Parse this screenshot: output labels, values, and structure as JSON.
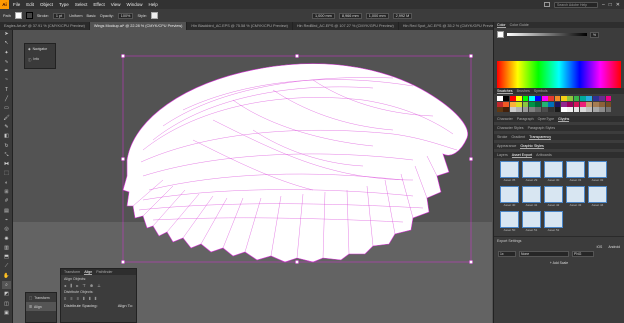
{
  "menubar": {
    "logo": "Ai",
    "items": [
      "File",
      "Edit",
      "Object",
      "Type",
      "Select",
      "Effect",
      "View",
      "Window",
      "Help"
    ],
    "search_placeholder": "Search Adobe Help"
  },
  "control": {
    "selection": "Path",
    "stroke_label": "Stroke:",
    "stroke_value": "1 pt",
    "uniform": "Uniform",
    "brush": "Basic",
    "opacity_label": "Opacity:",
    "opacity_value": "100%",
    "style_label": "Style:",
    "x": "1,000 mm",
    "y": "8,966 mm",
    "w": "1,000 mm",
    "h": "2,992 M"
  },
  "tabs": [
    "Eagles Art.ai* @ 37.91 % (CMYK/CPU Preview)",
    "Wings Mockup.ai* @ 22.28 % (CMYK/CPU Preview)",
    "Hin Blackbird_AC.EPS @ 75.58 % (CMYK/CPU Preview)",
    "Hin RedBird_AC.EPS @ 107.27 % (CMYK/GPU Preview)",
    "Hin Red Spot_AC.EPS @ 35.2 % (CMYK/GPU Preview)"
  ],
  "navigator": {
    "items": [
      "Navigator",
      "Info"
    ]
  },
  "panel": {
    "color_tabs": [
      "Color",
      "Color Guide"
    ],
    "color_value": "%",
    "swatch_tabs": [
      "Swatches",
      "Brushes",
      "Symbols"
    ],
    "char_tabs": [
      "Character",
      "Paragraph",
      "OpenType",
      "Glyphs"
    ],
    "style_tabs": [
      "Character Styles",
      "Paragraph Styles"
    ],
    "effect_tabs": [
      "Stroke",
      "Gradient",
      "Transparency"
    ],
    "appearance_tabs": [
      "Appearance",
      "Graphic Styles"
    ],
    "layers_tabs": [
      "Layers",
      "Asset Export",
      "Artboards"
    ],
    "assets": [
      "Asset 35",
      "Asset 29",
      "Asset 30",
      "Asset 31",
      "Asset 32",
      "Asset 40",
      "Asset 41",
      "Asset 42",
      "Asset 43",
      "Asset 44",
      "Asset 50",
      "Asset 51",
      "Asset 52"
    ],
    "export_settings": "Export Settings",
    "platform_buttons": [
      "iOS",
      "Android"
    ],
    "scale": "1x",
    "suffix": "None",
    "format": "PNG",
    "add_scale": "+ Add Scale"
  },
  "align": {
    "tabs": [
      "Transform",
      "Align",
      "Pathfinder"
    ],
    "align_objects": "Align Objects:",
    "distribute_objects": "Distribute Objects:",
    "distribute_spacing": "Distribute Spacing:",
    "align_to": "Align To:"
  },
  "transform_mini": {
    "items": [
      "Transform",
      "Align"
    ]
  },
  "colors": {
    "accent": "#4a86c8",
    "selection": "#d633d6",
    "artboard": "#636363",
    "brand": "#ff9a00"
  }
}
